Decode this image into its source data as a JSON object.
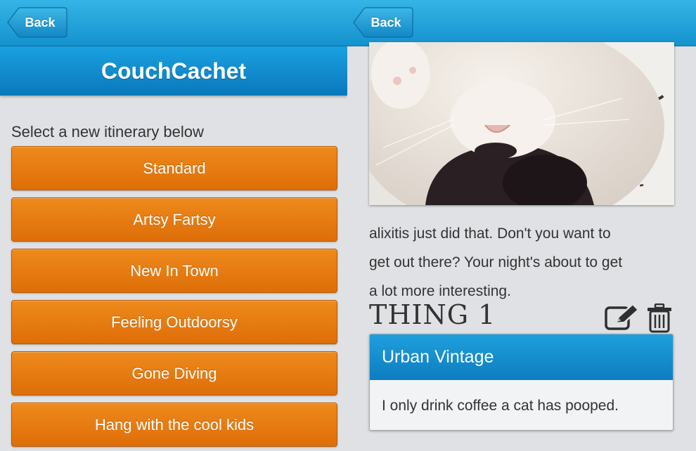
{
  "left": {
    "back_label": "Back",
    "title": "CouchCachet",
    "subtitle": "Select a new itinerary below",
    "itineraries": [
      "Standard",
      "Artsy Fartsy",
      "New In Town",
      "Feeling Outdoorsy",
      "Gone Diving",
      "Hang with the cool kids"
    ]
  },
  "right": {
    "back_label": "Back",
    "photo_icon": "cat-photo",
    "post_lines": [
      "alixitis just did that. Don't you want to",
      "get out there? Your night's about to get",
      "a lot more interesting."
    ],
    "thing_heading": "THING 1",
    "icons": [
      "edit-icon",
      "trash-icon"
    ],
    "card": {
      "title": "Urban Vintage",
      "body": "I only drink coffee a cat has pooped."
    }
  },
  "colors": {
    "nav_blue": "#1592cf",
    "title_blue": "#0a78bd",
    "orange": "#e57a10",
    "background": "#dfe1e4"
  }
}
